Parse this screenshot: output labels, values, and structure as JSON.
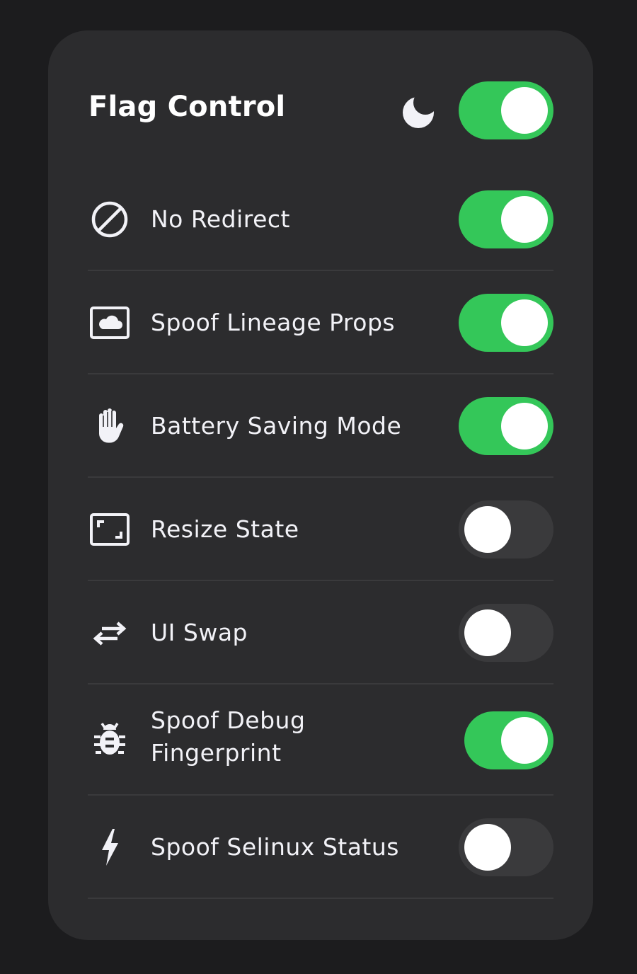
{
  "panel": {
    "title": "Flag Control",
    "theme_icon": "moon-icon",
    "master_toggle": true
  },
  "items": [
    {
      "label": "No Redirect",
      "icon": "block-icon",
      "enabled": true
    },
    {
      "label": "Spoof Lineage Props",
      "icon": "cloud-window-icon",
      "enabled": true
    },
    {
      "label": "Battery Saving Mode",
      "icon": "hand-icon",
      "enabled": true
    },
    {
      "label": "Resize State",
      "icon": "resize-frame-icon",
      "enabled": false
    },
    {
      "label": "UI Swap",
      "icon": "swap-arrows-icon",
      "enabled": false
    },
    {
      "label": "Spoof Debug Fingerprint",
      "icon": "bug-icon",
      "enabled": true
    },
    {
      "label": "Spoof Selinux Status",
      "icon": "bolt-icon",
      "enabled": false
    }
  ],
  "colors": {
    "background": "#1c1c1e",
    "card": "#2c2c2e",
    "toggle_on": "#34c759",
    "toggle_off": "#3a3a3c",
    "divider": "#3a3a3c"
  }
}
